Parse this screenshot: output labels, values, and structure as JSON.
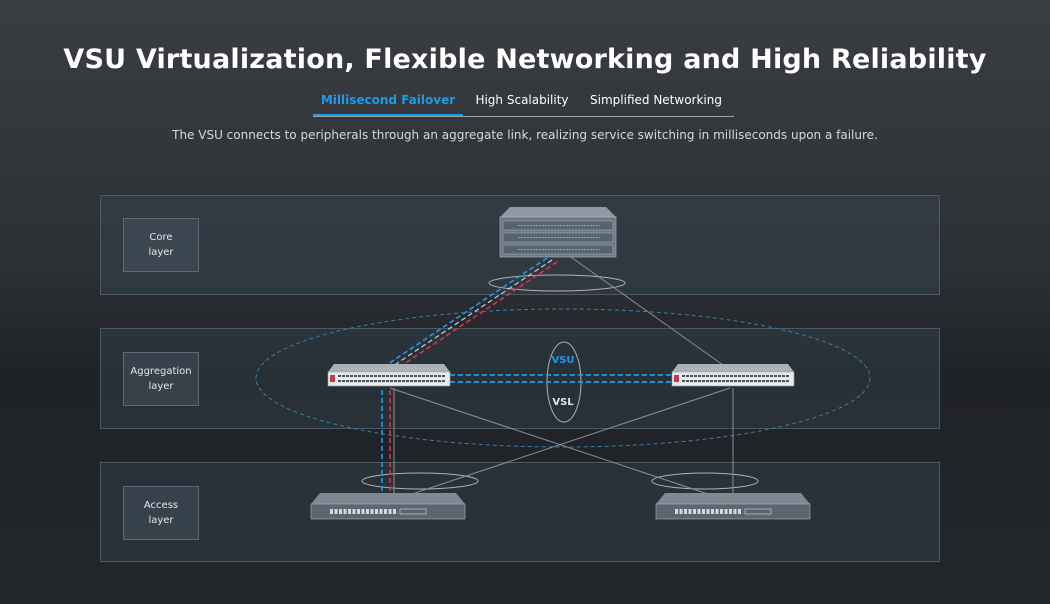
{
  "header": {
    "title": "VSU Virtualization, Flexible Networking and High Reliability",
    "description": "The VSU connects to peripherals through an aggregate link, realizing service switching in milliseconds upon a failure."
  },
  "tabs": [
    {
      "label": "Millisecond Failover",
      "active": true
    },
    {
      "label": "High Scalability",
      "active": false
    },
    {
      "label": "Simplified Networking",
      "active": false
    }
  ],
  "layers": [
    {
      "label": "Core\nlayer"
    },
    {
      "label": "Aggregation\nlayer"
    },
    {
      "label": "Access\nlayer"
    }
  ],
  "diagram": {
    "vsu_label": "VSU",
    "vsl_label": "VSL"
  },
  "colors": {
    "accent": "#1e9be6",
    "failover_red": "#d8344a",
    "link_gray": "#8a8f94"
  }
}
